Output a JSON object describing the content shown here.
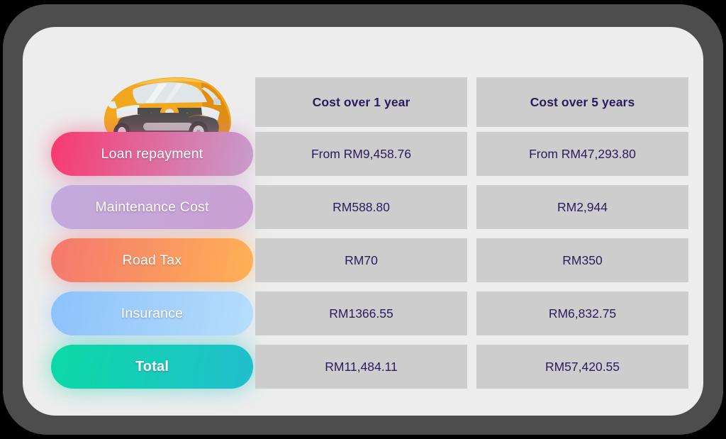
{
  "device": {
    "bezel_color": "#4d4d4d",
    "screen_background": "#ededed"
  },
  "illustration": {
    "name": "yellow-hatchback-car",
    "body_color": "#f2a81e",
    "body_shade_color": "#e08d12",
    "glass_color": "#dfe6e8",
    "bumper_color": "#4d4d4d"
  },
  "table": {
    "cell_background": "#cdcdcd",
    "text_color": "#2b1b5e",
    "headers": [
      "",
      "Cost over 1 year",
      "Cost over 5 years"
    ],
    "rows": [
      {
        "label": "Loan repayment",
        "pill_from": "#f8396f",
        "pill_to": "#c79dcd",
        "bold": false,
        "cost_1_year": "From RM9,458.76",
        "cost_5_years": "From RM47,293.80"
      },
      {
        "label": "Maintenance Cost",
        "pill_from": "#c3abdd",
        "pill_to": "#caa0d3",
        "bold": false,
        "cost_1_year": "RM588.80",
        "cost_5_years": "RM2,944"
      },
      {
        "label": "Road Tax",
        "pill_from": "#f4786f",
        "pill_to": "#ffb155",
        "bold": false,
        "cost_1_year": "RM70",
        "cost_5_years": "RM350"
      },
      {
        "label": "Insurance",
        "pill_from": "#8cc2fb",
        "pill_to": "#b6ddfb",
        "bold": false,
        "cost_1_year": "RM1366.55",
        "cost_5_years": "RM6,832.75"
      },
      {
        "label": "Total",
        "pill_from": "#0cd9a5",
        "pill_to": "#20bfce",
        "bold": true,
        "cost_1_year": "RM11,484.11",
        "cost_5_years": "RM57,420.55"
      }
    ]
  }
}
